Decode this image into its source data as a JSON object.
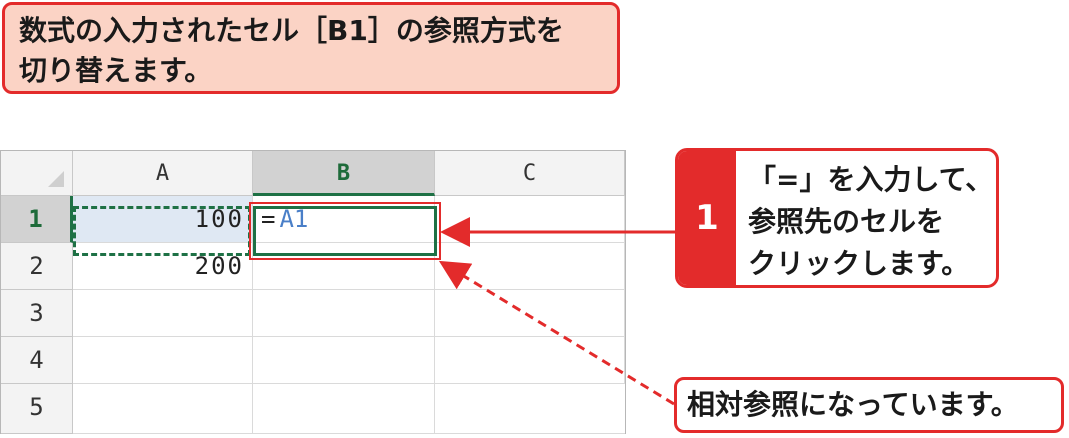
{
  "instruction": {
    "lines": [
      "数式の入力されたセル［B1］の参照方式を",
      "切り替えます。"
    ]
  },
  "sheet": {
    "columns": [
      "A",
      "B",
      "C"
    ],
    "rows": [
      "1",
      "2",
      "3",
      "4",
      "5"
    ],
    "cells": {
      "A1": "100",
      "A2": "200",
      "B1_eq": "=",
      "B1_ref": "A1"
    },
    "active_column": "B",
    "active_row": "1"
  },
  "step": {
    "number": "1",
    "lines": [
      "「=」を入力して、",
      "参照先のセルを",
      "クリックします。"
    ]
  },
  "note": {
    "text": "相対参照になっています。"
  },
  "colors": {
    "accent_red": "#e32b2b",
    "excel_green": "#1e7145",
    "ref_blue": "#4a7fc8",
    "callout_fill": "#fbd3c5"
  }
}
